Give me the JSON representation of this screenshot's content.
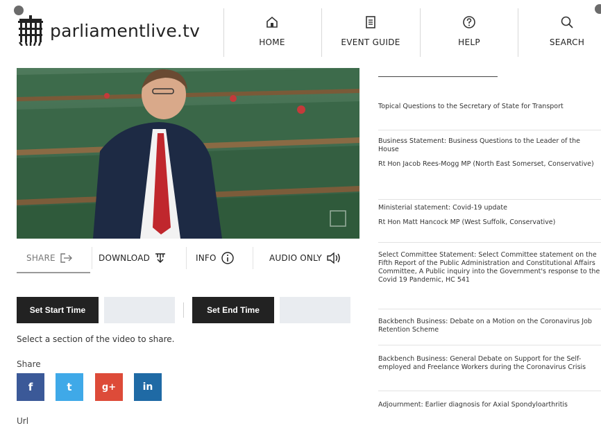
{
  "header": {
    "site_name": "parliamentlive.tv",
    "nav": [
      {
        "label": "HOME",
        "icon": "home-icon"
      },
      {
        "label": "EVENT GUIDE",
        "icon": "event-guide-icon"
      },
      {
        "label": "HELP",
        "icon": "help-icon"
      },
      {
        "label": "SEARCH",
        "icon": "search-icon"
      }
    ]
  },
  "toolbar": {
    "share": "SHARE",
    "download": "DOWNLOAD",
    "info": "INFO",
    "audio_only": "AUDIO ONLY"
  },
  "clip": {
    "set_start": "Set Start Time",
    "start_value": "",
    "set_end": "Set End Time",
    "end_value": "",
    "hint": "Select a section of the video to share."
  },
  "share": {
    "label": "Share",
    "networks": [
      {
        "name": "facebook",
        "glyph": "f",
        "color": "#3b5998"
      },
      {
        "name": "twitter",
        "glyph": "t",
        "color": "#3fa9e8"
      },
      {
        "name": "google-plus",
        "glyph": "g+",
        "color": "#dd4b39"
      },
      {
        "name": "linkedin",
        "glyph": "in",
        "color": "#1f6aa5"
      }
    ],
    "url_label": "Url"
  },
  "events": [
    {
      "title": "Topical Questions to the Secretary of State for Transport",
      "subtitle": ""
    },
    {
      "title": "Business Statement: Business Questions to the Leader of the House",
      "subtitle": "Rt Hon Jacob Rees-Mogg MP (North East Somerset, Conservative)"
    },
    {
      "title": "Ministerial statement: Covid-19 update",
      "subtitle": "Rt Hon Matt Hancock MP (West Suffolk, Conservative)"
    },
    {
      "title": "Select Committee Statement: Select Committee statement on the Fifth Report of the Public Administration and Constitutional Affairs Committee, A Public inquiry into the Government's response to the Covid 19 Pandemic, HC 541",
      "subtitle": ""
    },
    {
      "title": "Backbench Business: Debate on a Motion on the Coronavirus Job Retention Scheme",
      "subtitle": ""
    },
    {
      "title": "Backbench Business: General Debate on Support for the Self-employed and Freelance Workers during the Coronavirus Crisis",
      "subtitle": ""
    },
    {
      "title": "Adjournment: Earlier diagnosis for Axial Spondyloarthritis",
      "subtitle": ""
    }
  ]
}
